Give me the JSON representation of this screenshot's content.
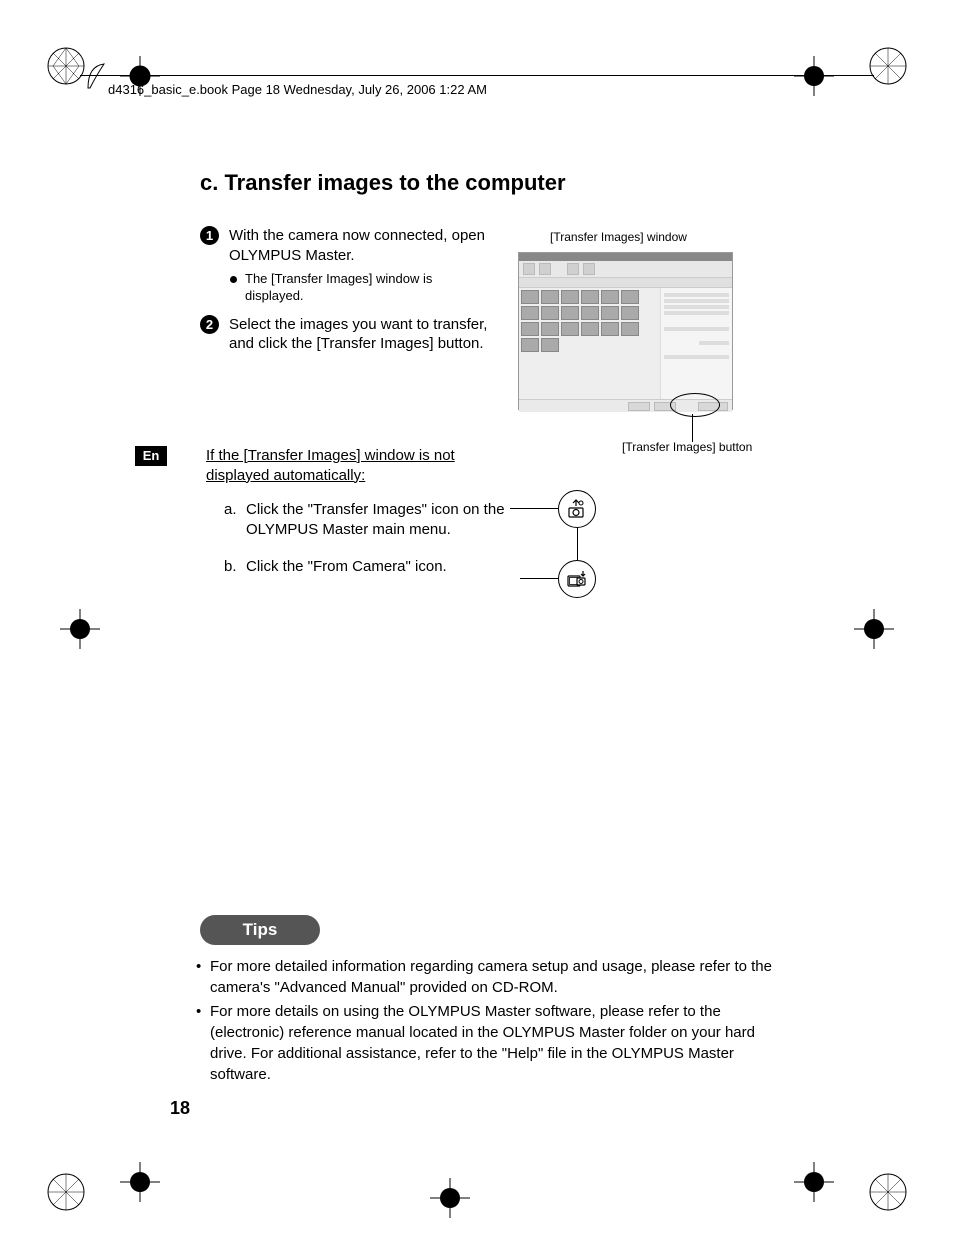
{
  "header": "d4316_basic_e.book  Page 18  Wednesday, July 26, 2006  1:22 AM",
  "heading": "c. Transfer images to the computer",
  "steps": [
    {
      "num": "1",
      "text": "With the camera now connected, open OLYMPUS Master."
    },
    {
      "num": "2",
      "text": "Select the images you want to transfer, and click the [Transfer Images] button."
    }
  ],
  "bullet": "The [Transfer Images] window is displayed.",
  "caption_window": "[Transfer Images] window",
  "caption_button": "[Transfer Images] button",
  "lang_badge": "En",
  "subsection_intro": "If the [Transfer Images] window is not displayed automatically:",
  "sub_a": {
    "letter": "a.",
    "text": "Click the \"Transfer Images\" icon on the OLYMPUS Master main menu."
  },
  "sub_b": {
    "letter": "b.",
    "text": "Click the \"From Camera\" icon."
  },
  "tips_label": "Tips",
  "tips": [
    "For more detailed information regarding camera setup and usage, please refer to the camera's \"Advanced Manual\" provided on CD-ROM.",
    "For more details on using the OLYMPUS Master software, please refer to the (electronic) reference manual located in the OLYMPUS Master folder on your hard drive. For additional assistance, refer to the \"Help\" file in the OLYMPUS Master software."
  ],
  "page_number": "18"
}
